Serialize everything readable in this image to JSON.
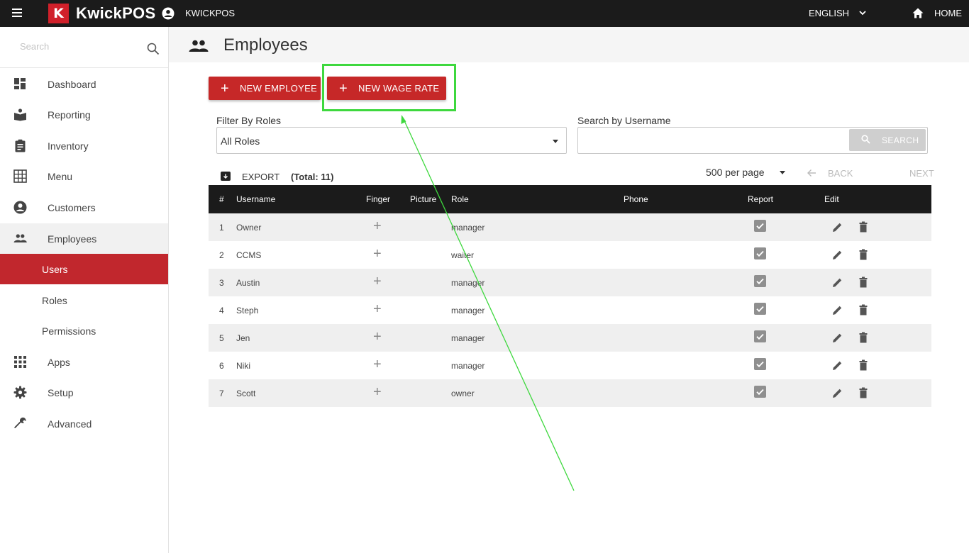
{
  "topbar": {
    "logo_letter": "K",
    "app_name": "KwickPOS",
    "store_name": "KWICKPOS",
    "language": "ENGLISH",
    "home": "HOME"
  },
  "sidebar": {
    "search_placeholder": "Search",
    "items": [
      {
        "label": "Dashboard",
        "icon": "dashboard-icon"
      },
      {
        "label": "Reporting",
        "icon": "reporting-icon"
      },
      {
        "label": "Inventory",
        "icon": "clipboard-icon"
      },
      {
        "label": "Menu",
        "icon": "grid-icon"
      },
      {
        "label": "Customers",
        "icon": "customer-icon"
      },
      {
        "label": "Employees",
        "icon": "people-icon"
      }
    ],
    "subitems": [
      {
        "label": "Users"
      },
      {
        "label": "Roles"
      },
      {
        "label": "Permissions"
      }
    ],
    "items_after": [
      {
        "label": "Apps",
        "icon": "apps-icon"
      },
      {
        "label": "Setup",
        "icon": "gear-icon"
      },
      {
        "label": "Advanced",
        "icon": "wrench-icon"
      }
    ]
  },
  "page": {
    "title": "Employees",
    "new_employee": "NEW EMPLOYEE",
    "new_wage_rate": "NEW WAGE RATE",
    "filter_label": "Filter By Roles",
    "filter_value": "All Roles",
    "search_label": "Search by Username",
    "search_button": "SEARCH",
    "export": "EXPORT",
    "total": "(Total: 11)",
    "per_page": "500 per page",
    "back": "BACK",
    "next": "NEXT"
  },
  "table": {
    "headers": [
      "#",
      "Username",
      "Finger",
      "Picture",
      "Role",
      "Phone",
      "Report",
      "Edit"
    ],
    "rows": [
      {
        "num": "1",
        "username": "Owner",
        "role": "manager"
      },
      {
        "num": "2",
        "username": "CCMS",
        "role": "waiter"
      },
      {
        "num": "3",
        "username": "Austin",
        "role": "manager"
      },
      {
        "num": "4",
        "username": "Steph",
        "role": "manager"
      },
      {
        "num": "5",
        "username": "Jen",
        "role": "manager"
      },
      {
        "num": "6",
        "username": "Niki",
        "role": "manager"
      },
      {
        "num": "7",
        "username": "Scott",
        "role": "owner"
      }
    ]
  },
  "colors": {
    "brand_red": "#c62828",
    "topbar": "#1b1b1b",
    "annotation_green": "#3ed83e"
  }
}
